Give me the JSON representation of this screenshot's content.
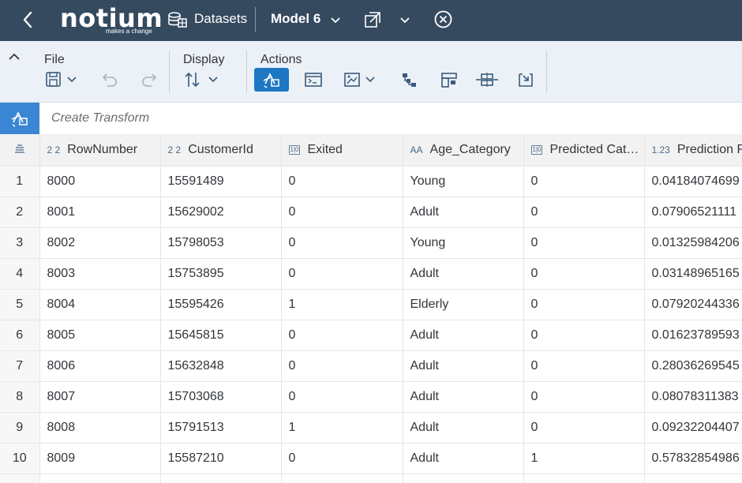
{
  "header": {
    "logo_word": "notium",
    "logo_tagline": "makes a change",
    "datasets_label": "Datasets",
    "model_label": "Model 6"
  },
  "toolbar": {
    "file_label": "File",
    "display_label": "Display",
    "actions_label": "Actions"
  },
  "transform": {
    "placeholder": "Create Transform"
  },
  "grid": {
    "columns": [
      {
        "type_icon": "2 2",
        "name": "RowNumber"
      },
      {
        "type_icon": "2 2",
        "name": "CustomerId"
      },
      {
        "type_icon": "1|0",
        "name": "Exited"
      },
      {
        "type_icon": "AA",
        "name": "Age_Category"
      },
      {
        "type_icon": "1|0",
        "name": "Predicted Category"
      },
      {
        "type_icon": "1.23",
        "name": "Prediction Probability"
      }
    ],
    "rows": [
      {
        "n": "1",
        "cells": [
          "8000",
          "15591489",
          "0",
          "Young",
          "0",
          "0.04184074699"
        ]
      },
      {
        "n": "2",
        "cells": [
          "8001",
          "15629002",
          "0",
          "Adult",
          "0",
          "0.07906521111"
        ]
      },
      {
        "n": "3",
        "cells": [
          "8002",
          "15798053",
          "0",
          "Young",
          "0",
          "0.01325984206"
        ]
      },
      {
        "n": "4",
        "cells": [
          "8003",
          "15753895",
          "0",
          "Adult",
          "0",
          "0.03148965165"
        ]
      },
      {
        "n": "5",
        "cells": [
          "8004",
          "15595426",
          "1",
          "Elderly",
          "0",
          "0.07920244336"
        ]
      },
      {
        "n": "6",
        "cells": [
          "8005",
          "15645815",
          "0",
          "Adult",
          "0",
          "0.01623789593"
        ]
      },
      {
        "n": "7",
        "cells": [
          "8006",
          "15632848",
          "0",
          "Adult",
          "0",
          "0.28036269545"
        ]
      },
      {
        "n": "8",
        "cells": [
          "8007",
          "15703068",
          "0",
          "Adult",
          "0",
          "0.08078311383"
        ]
      },
      {
        "n": "9",
        "cells": [
          "8008",
          "15791513",
          "1",
          "Adult",
          "0",
          "0.09232204407"
        ]
      },
      {
        "n": "10",
        "cells": [
          "8009",
          "15587210",
          "0",
          "Adult",
          "1",
          "0.57832854986"
        ]
      },
      {
        "n": "",
        "cells": [
          "",
          "",
          "",
          "",
          "",
          ""
        ]
      }
    ]
  }
}
